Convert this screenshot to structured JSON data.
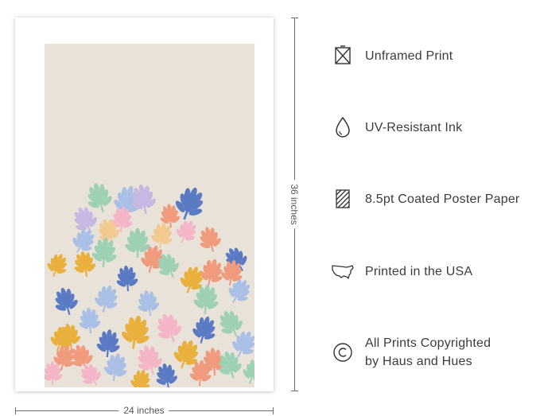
{
  "poster": {
    "background_color": "#e8e2d8",
    "leaf_colors": [
      "#5b7ac4",
      "#e9b03d",
      "#f09a7e",
      "#9ed0b4",
      "#f4b6c6",
      "#a9bfe6",
      "#c6b8e3",
      "#f2c98f"
    ]
  },
  "dimensions": {
    "height_label": "36 inches",
    "width_label": "24 inches"
  },
  "features": [
    {
      "icon": "unframed-icon",
      "label": "Unframed Print"
    },
    {
      "icon": "ink-drop-icon",
      "label": "UV-Resistant Ink"
    },
    {
      "icon": "paper-icon",
      "label": "8.5pt Coated Poster Paper"
    },
    {
      "icon": "usa-map-icon",
      "label": "Printed in the USA"
    },
    {
      "icon": "copyright-icon",
      "label": "All Prints Copyrighted",
      "label2": "by Haus and Hues"
    }
  ]
}
